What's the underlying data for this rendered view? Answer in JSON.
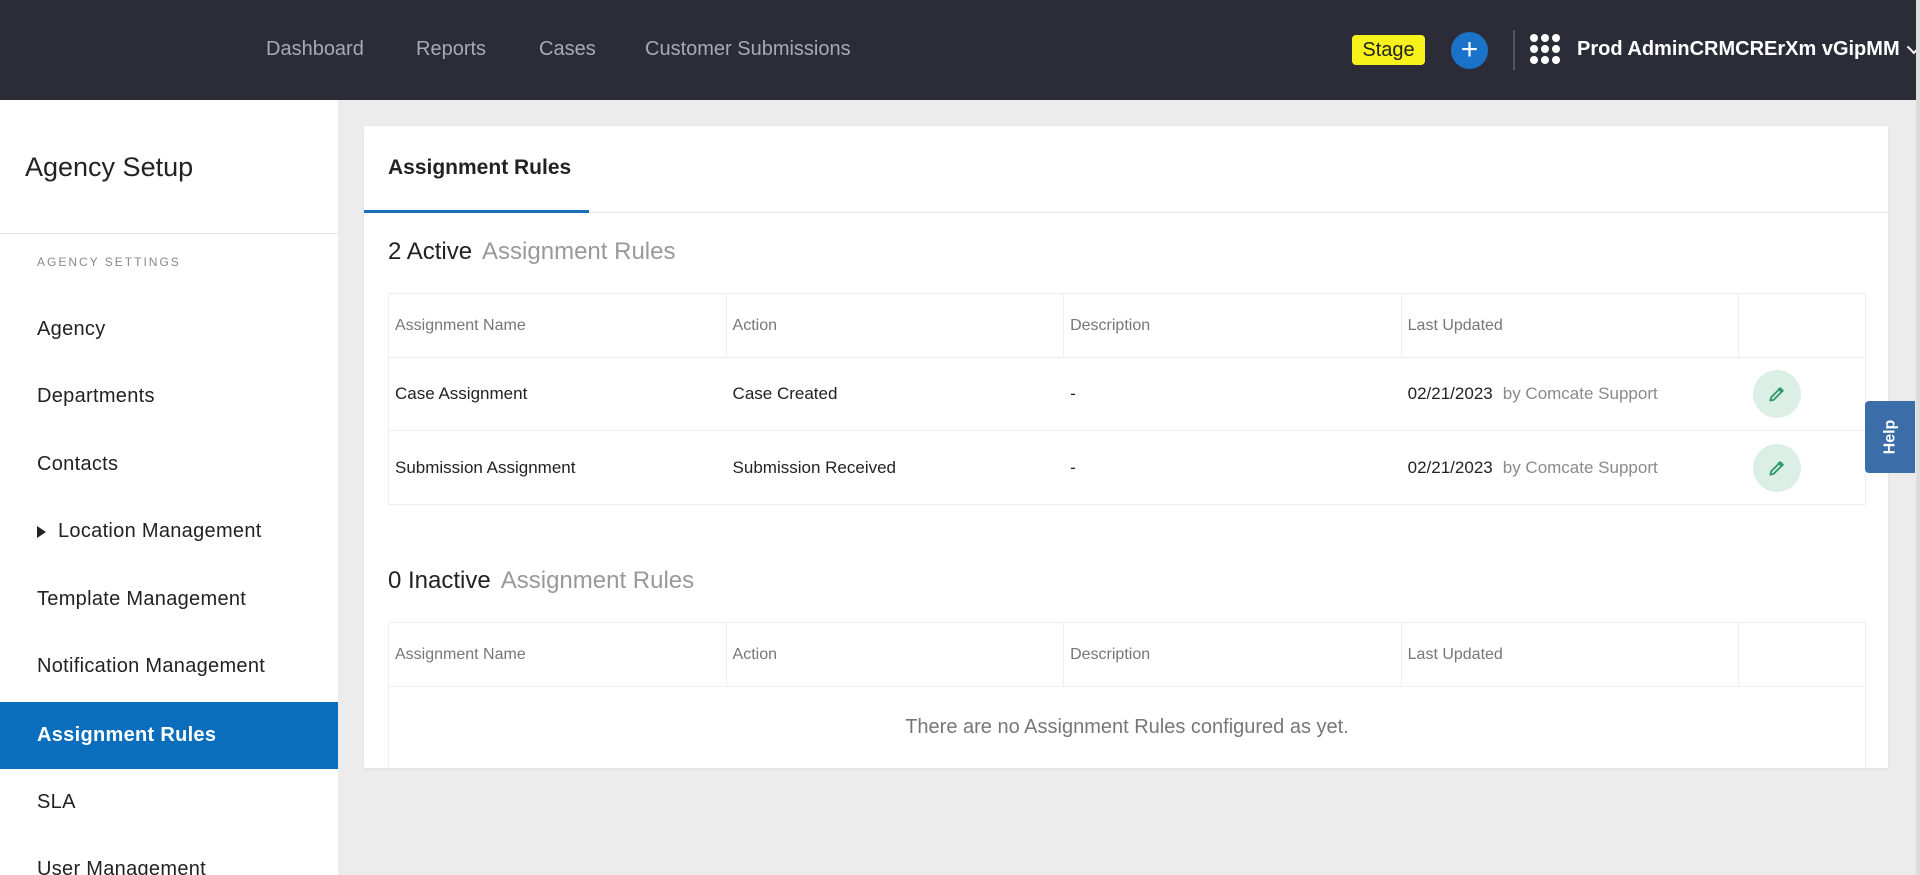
{
  "topbar": {
    "nav": [
      "Dashboard",
      "Reports",
      "Cases",
      "Customer Submissions"
    ],
    "environment_badge": "Stage",
    "add_icon": "plus-icon",
    "apps_icon": "grid-dots-icon",
    "user_name": "Prod AdminCRMCRErXm vGipMM",
    "user_menu_icon": "chevron-down-icon"
  },
  "sidebar": {
    "title": "Agency Setup",
    "section_label": "AGENCY SETTINGS",
    "items": [
      {
        "label": "Agency"
      },
      {
        "label": "Departments"
      },
      {
        "label": "Contacts"
      },
      {
        "label": "Location Management",
        "expandable": true
      },
      {
        "label": "Template Management"
      },
      {
        "label": "Notification Management"
      },
      {
        "label": "Assignment Rules",
        "active": true
      },
      {
        "label": "SLA"
      },
      {
        "label": "User Management"
      }
    ]
  },
  "main": {
    "tab": "Assignment Rules",
    "active_section": {
      "count_label": "2 Active",
      "sub_label": "Assignment Rules",
      "columns": [
        "Assignment Name",
        "Action",
        "Description",
        "Last Updated"
      ],
      "rows": [
        {
          "name": "Case Assignment",
          "action": "Case Created",
          "description": "-",
          "date": "02/21/2023",
          "by": "by Comcate Support"
        },
        {
          "name": "Submission Assignment",
          "action": "Submission Received",
          "description": "-",
          "date": "02/21/2023",
          "by": "by Comcate Support"
        }
      ]
    },
    "inactive_section": {
      "count_label": "0 Inactive",
      "sub_label": "Assignment Rules",
      "columns": [
        "Assignment Name",
        "Action",
        "Description",
        "Last Updated"
      ],
      "empty_message": "There are no Assignment Rules configured as yet."
    }
  },
  "help": {
    "label": "Help"
  },
  "colors": {
    "topbar": "#2c2c38",
    "accent": "#0a6ebd",
    "badge": "#f7f21a",
    "edit_button_bg": "#dcefe6",
    "edit_icon": "#2e9a6a"
  }
}
